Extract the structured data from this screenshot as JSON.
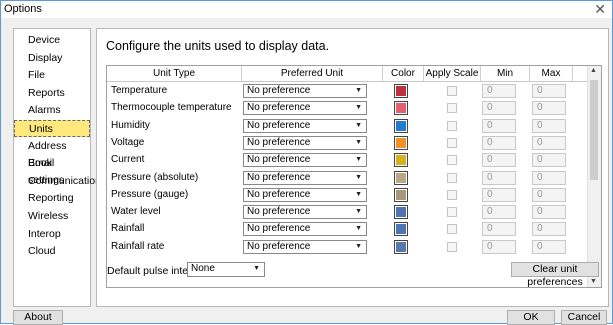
{
  "window": {
    "title": "Options",
    "close_glyph": "✕"
  },
  "sidebar": {
    "items": [
      {
        "label": "Device"
      },
      {
        "label": "Display"
      },
      {
        "label": "File"
      },
      {
        "label": "Reports"
      },
      {
        "label": "Alarms"
      },
      {
        "label": "Units",
        "selected": true
      },
      {
        "label": "Address Book"
      },
      {
        "label": "Email settings"
      },
      {
        "label": "Communication"
      },
      {
        "label": "Reporting"
      },
      {
        "label": "Wireless"
      },
      {
        "label": "Interop"
      },
      {
        "label": "Cloud"
      }
    ]
  },
  "content": {
    "heading": "Configure the units used to display data.",
    "columns": {
      "unit_type": "Unit Type",
      "preferred_unit": "Preferred Unit",
      "color": "Color",
      "apply_scale": "Apply Scale",
      "min": "Min",
      "max": "Max"
    },
    "rows": [
      {
        "name": "Temperature",
        "unit": "No preference",
        "color": "#c0303c",
        "min": "0",
        "max": "0"
      },
      {
        "name": "Thermocouple temperature",
        "unit": "No preference",
        "color": "#e06070",
        "min": "0",
        "max": "0"
      },
      {
        "name": "Humidity",
        "unit": "No preference",
        "color": "#1f7ccf",
        "min": "0",
        "max": "0"
      },
      {
        "name": "Voltage",
        "unit": "No preference",
        "color": "#f0902a",
        "min": "0",
        "max": "0"
      },
      {
        "name": "Current",
        "unit": "No preference",
        "color": "#d4b21e",
        "min": "0",
        "max": "0"
      },
      {
        "name": "Pressure (absolute)",
        "unit": "No preference",
        "color": "#b8a888",
        "min": "0",
        "max": "0"
      },
      {
        "name": "Pressure (gauge)",
        "unit": "No preference",
        "color": "#a89878",
        "min": "0",
        "max": "0"
      },
      {
        "name": "Water level",
        "unit": "No preference",
        "color": "#4e74b4",
        "min": "0",
        "max": "0"
      },
      {
        "name": "Rainfall",
        "unit": "No preference",
        "color": "#4e74b4",
        "min": "0",
        "max": "0"
      },
      {
        "name": "Rainfall rate",
        "unit": "No preference",
        "color": "#5878ac",
        "min": "0",
        "max": "0"
      }
    ],
    "pulse": {
      "label": "Default pulse interval:",
      "value": "None"
    },
    "clear_label": "Clear unit preferences"
  },
  "footer": {
    "about_label": "About",
    "ok_label": "OK",
    "cancel_label": "Cancel"
  }
}
